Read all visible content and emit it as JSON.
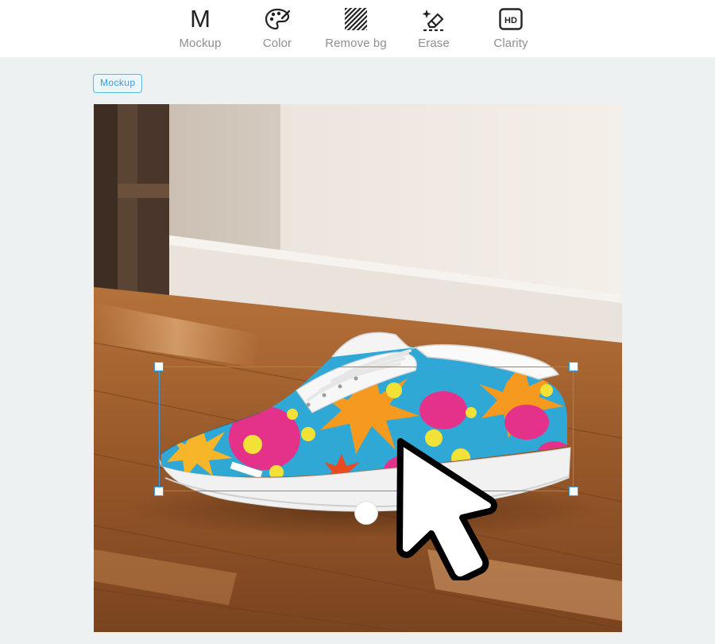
{
  "toolbar": {
    "tools": [
      {
        "label": "Mockup",
        "icon": "letter-m-icon"
      },
      {
        "label": "Color",
        "icon": "palette-icon"
      },
      {
        "label": "Remove bg",
        "icon": "hatched-square-icon"
      },
      {
        "label": "Erase",
        "icon": "eraser-sparkle-icon"
      },
      {
        "label": "Clarity",
        "icon": "hd-icon",
        "icon_text": "HD"
      }
    ],
    "mockup_glyph": "M"
  },
  "badge": {
    "label": "Mockup"
  },
  "colors": {
    "accent": "#3d9be0",
    "toolbar_label": "#8f8f8f",
    "page_background": "#eef1f2"
  }
}
